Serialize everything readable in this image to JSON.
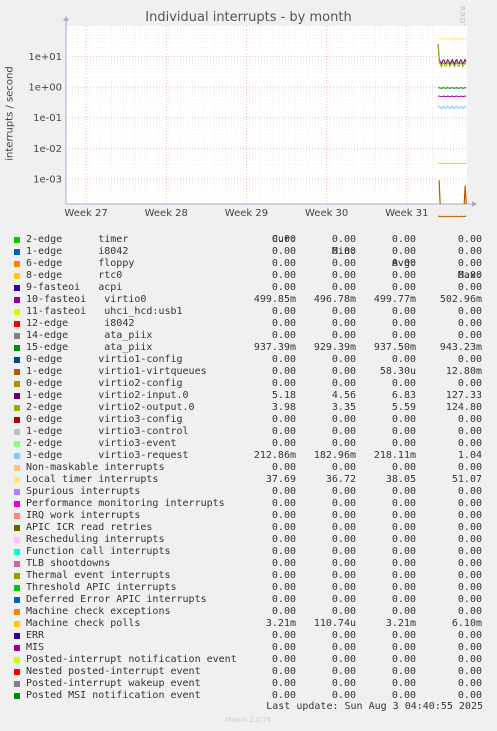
{
  "title": "Individual interrupts - by month",
  "watermark": "RRDTOOL / TOBI OETIKER",
  "footer": "Munin 2.0.76",
  "last_update": "Last update: Sun Aug  3 04:40:55 2025",
  "chart_data": {
    "type": "line",
    "title": "Individual interrupts - by month",
    "ylabel": "interrupts / second",
    "xlabel": "",
    "y_scale": "log",
    "ylim": [
      0.00015,
      100
    ],
    "y_ticks": [
      "1e+01",
      "1e+00",
      "1e-01",
      "1e-02",
      "1e-03"
    ],
    "y_tick_values": [
      10,
      1,
      0.1,
      0.01,
      0.001
    ],
    "x_ticks": [
      "Week 27",
      "Week 28",
      "Week 29",
      "Week 30",
      "Week 31"
    ],
    "grid": true,
    "legend_columns": [
      "Cur:",
      "Min:",
      "Avg:",
      "Max:"
    ],
    "series": [
      {
        "name": "2-edge      timer",
        "color": "#00cc00",
        "cur": "0.00",
        "min": "0.00",
        "avg": "0.00",
        "max": "0.00"
      },
      {
        "name": "1-edge      i8042",
        "color": "#0066b3",
        "cur": "0.00",
        "min": "0.00",
        "avg": "0.00",
        "max": "0.00"
      },
      {
        "name": "6-edge      floppy",
        "color": "#ff8000",
        "cur": "0.00",
        "min": "0.00",
        "avg": "0.00",
        "max": "0.00"
      },
      {
        "name": "8-edge      rtc0",
        "color": "#ffcc00",
        "cur": "0.00",
        "min": "0.00",
        "avg": "0.00",
        "max": "0.00"
      },
      {
        "name": "9-fasteoi   acpi",
        "color": "#330099",
        "cur": "0.00",
        "min": "0.00",
        "avg": "0.00",
        "max": "0.00"
      },
      {
        "name": "10-fasteoi   virtio0",
        "color": "#990099",
        "cur": "499.85m",
        "min": "496.78m",
        "avg": "499.77m",
        "max": "502.96m"
      },
      {
        "name": "11-fasteoi   uhci_hcd:usb1",
        "color": "#ccff00",
        "cur": "0.00",
        "min": "0.00",
        "avg": "0.00",
        "max": "0.00"
      },
      {
        "name": "12-edge      i8042",
        "color": "#ff0000",
        "cur": "0.00",
        "min": "0.00",
        "avg": "0.00",
        "max": "0.00"
      },
      {
        "name": "14-edge      ata_piix",
        "color": "#808080",
        "cur": "0.00",
        "min": "0.00",
        "avg": "0.00",
        "max": "0.00"
      },
      {
        "name": "15-edge      ata_piix",
        "color": "#008f00",
        "cur": "937.39m",
        "min": "929.39m",
        "avg": "937.50m",
        "max": "943.23m"
      },
      {
        "name": "0-edge      virtio1-config",
        "color": "#00487d",
        "cur": "0.00",
        "min": "0.00",
        "avg": "0.00",
        "max": "0.00"
      },
      {
        "name": "1-edge      virtio1-virtqueues",
        "color": "#b35a00",
        "cur": "0.00",
        "min": "0.00",
        "avg": "58.30u",
        "max": "12.80m"
      },
      {
        "name": "0-edge      virtio2-config",
        "color": "#b38f00",
        "cur": "0.00",
        "min": "0.00",
        "avg": "0.00",
        "max": "0.00"
      },
      {
        "name": "1-edge      virtio2-input.0",
        "color": "#6b006b",
        "cur": "5.18",
        "min": "4.56",
        "avg": "6.83",
        "max": "127.33"
      },
      {
        "name": "2-edge      virtio2-output.0",
        "color": "#8fb300",
        "cur": "3.98",
        "min": "3.35",
        "avg": "5.59",
        "max": "124.80"
      },
      {
        "name": "0-edge      virtio3-config",
        "color": "#b30000",
        "cur": "0.00",
        "min": "0.00",
        "avg": "0.00",
        "max": "0.00"
      },
      {
        "name": "1-edge      virtio3-control",
        "color": "#bebebe",
        "cur": "0.00",
        "min": "0.00",
        "avg": "0.00",
        "max": "0.00"
      },
      {
        "name": "2-edge      virtio3-event",
        "color": "#80ff80",
        "cur": "0.00",
        "min": "0.00",
        "avg": "0.00",
        "max": "0.00"
      },
      {
        "name": "3-edge      virtio3-request",
        "color": "#80c9ff",
        "cur": "212.86m",
        "min": "182.96m",
        "avg": "218.11m",
        "max": "1.04"
      },
      {
        "name": "Non-maskable interrupts",
        "color": "#ffc080",
        "cur": "0.00",
        "min": "0.00",
        "avg": "0.00",
        "max": "0.00"
      },
      {
        "name": "Local timer interrupts",
        "color": "#ffe680",
        "cur": "37.69",
        "min": "36.72",
        "avg": "38.05",
        "max": "51.07"
      },
      {
        "name": "Spurious interrupts",
        "color": "#aa80ff",
        "cur": "0.00",
        "min": "0.00",
        "avg": "0.00",
        "max": "0.00"
      },
      {
        "name": "Performance monitoring interrupts",
        "color": "#ee00cc",
        "cur": "0.00",
        "min": "0.00",
        "avg": "0.00",
        "max": "0.00"
      },
      {
        "name": "IRQ work interrupts",
        "color": "#ff8080",
        "cur": "0.00",
        "min": "0.00",
        "avg": "0.00",
        "max": "0.00"
      },
      {
        "name": "APIC ICR read retries",
        "color": "#666600",
        "cur": "0.00",
        "min": "0.00",
        "avg": "0.00",
        "max": "0.00"
      },
      {
        "name": "Rescheduling interrupts",
        "color": "#ffbfff",
        "cur": "0.00",
        "min": "0.00",
        "avg": "0.00",
        "max": "0.00"
      },
      {
        "name": "Function call interrupts",
        "color": "#00ffcc",
        "cur": "0.00",
        "min": "0.00",
        "avg": "0.00",
        "max": "0.00"
      },
      {
        "name": "TLB shootdowns",
        "color": "#cc6699",
        "cur": "0.00",
        "min": "0.00",
        "avg": "0.00",
        "max": "0.00"
      },
      {
        "name": "Thermal event interrupts",
        "color": "#999900",
        "cur": "0.00",
        "min": "0.00",
        "avg": "0.00",
        "max": "0.00"
      },
      {
        "name": "Threshold APIC interrupts",
        "color": "#00cc00",
        "cur": "0.00",
        "min": "0.00",
        "avg": "0.00",
        "max": "0.00"
      },
      {
        "name": "Deferred Error APIC interrupts",
        "color": "#0066b3",
        "cur": "0.00",
        "min": "0.00",
        "avg": "0.00",
        "max": "0.00"
      },
      {
        "name": "Machine check exceptions",
        "color": "#ff8000",
        "cur": "0.00",
        "min": "0.00",
        "avg": "0.00",
        "max": "0.00"
      },
      {
        "name": "Machine check polls",
        "color": "#ffcc00",
        "cur": "3.21m",
        "min": "110.74u",
        "avg": "3.21m",
        "max": "6.10m"
      },
      {
        "name": "ERR",
        "color": "#330099",
        "cur": "0.00",
        "min": "0.00",
        "avg": "0.00",
        "max": "0.00"
      },
      {
        "name": "MIS",
        "color": "#990099",
        "cur": "0.00",
        "min": "0.00",
        "avg": "0.00",
        "max": "0.00"
      },
      {
        "name": "Posted-interrupt notification event",
        "color": "#ccff00",
        "cur": "0.00",
        "min": "0.00",
        "avg": "0.00",
        "max": "0.00"
      },
      {
        "name": "Nested posted-interrupt event",
        "color": "#ff0000",
        "cur": "0.00",
        "min": "0.00",
        "avg": "0.00",
        "max": "0.00"
      },
      {
        "name": "Posted-interrupt wakeup event",
        "color": "#808080",
        "cur": "0.00",
        "min": "0.00",
        "avg": "0.00",
        "max": "0.00"
      },
      {
        "name": "Posted MSI notification event",
        "color": "#008f00",
        "cur": "0.00",
        "min": "0.00",
        "avg": "0.00",
        "max": "0.00"
      }
    ]
  }
}
